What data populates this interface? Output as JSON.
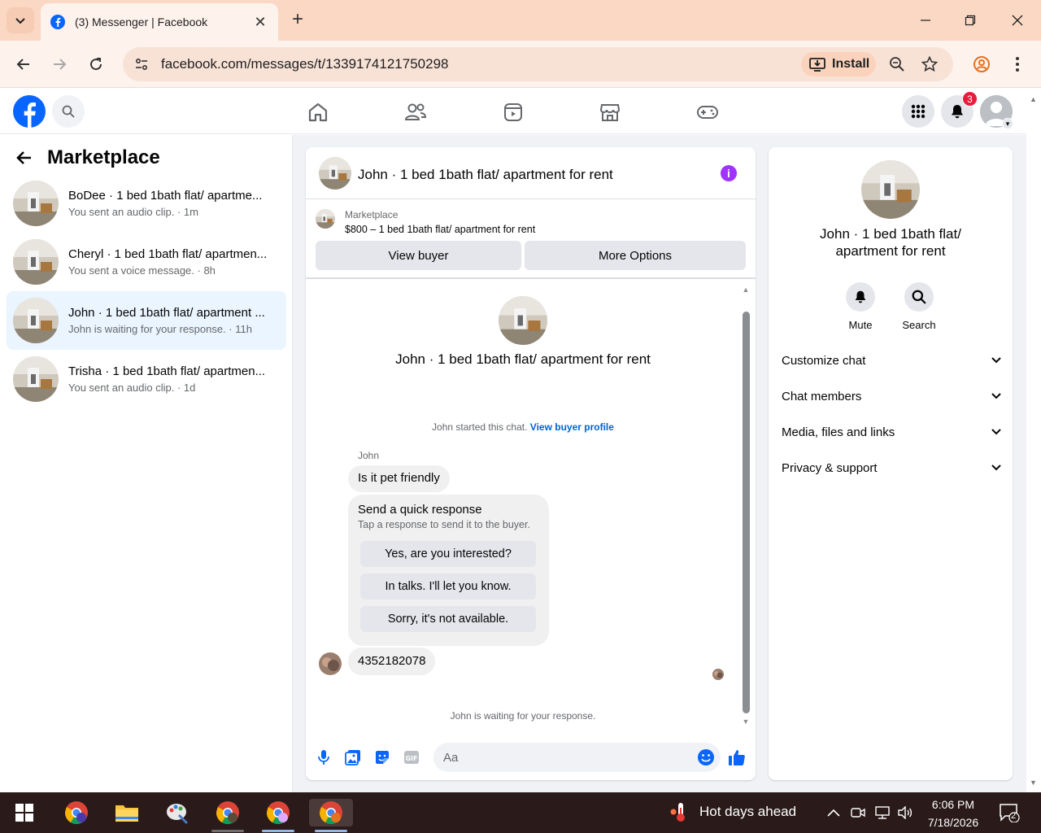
{
  "browser": {
    "tab_title": "(3) Messenger | Facebook",
    "url": "facebook.com/messages/t/1339174121750298",
    "install_label": "Install"
  },
  "header": {
    "notification_count": "3"
  },
  "sidebar": {
    "title": "Marketplace",
    "conversations": [
      {
        "name": "BoDee · 1 bed 1bath flat/ apartme...",
        "snippet": "You sent an audio clip. · 1m",
        "active": false
      },
      {
        "name": "Cheryl · 1 bed 1bath flat/ apartmen...",
        "snippet": "You sent a voice message. · 8h",
        "active": false
      },
      {
        "name": "John · 1 bed 1bath flat/ apartment ...",
        "snippet": "John is waiting for your response. · 11h",
        "active": true
      },
      {
        "name": "Trisha · 1 bed 1bath flat/ apartmen...",
        "snippet": "You sent an audio clip. · 1d",
        "active": false
      }
    ]
  },
  "chat": {
    "title": "John · 1 bed 1bath flat/ apartment for rent",
    "marketplace_label": "Marketplace",
    "listing": "$800 – 1 bed 1bath flat/ apartment for rent",
    "view_buyer": "View buyer",
    "more_options": "More Options",
    "intro_title": "John · 1 bed 1bath flat/ apartment for rent",
    "started_text": "John started this chat.",
    "view_buyer_profile": "View buyer profile",
    "sender_name": "John",
    "message_1": "Is it pet friendly",
    "quick_response_title": "Send a quick response",
    "quick_response_sub": "Tap a response to send it to the buyer.",
    "quick_responses": [
      "Yes, are you interested?",
      "In talks. I'll let you know.",
      "Sorry, it's not available."
    ],
    "message_2": "4352182078",
    "waiting_text": "John is waiting for your response.",
    "composer_placeholder": "Aa"
  },
  "details": {
    "title": "John · 1 bed 1bath flat/ apartment for rent",
    "mute_label": "Mute",
    "search_label": "Search",
    "sections": [
      "Customize chat",
      "Chat members",
      "Media, files and links",
      "Privacy & support"
    ]
  },
  "taskbar": {
    "weather": "Hot days ahead",
    "time": "6:06 PM",
    "date": "7/18/2026",
    "notifications": "2"
  },
  "colors": {
    "fb_blue": "#0866ff",
    "active_conv_bg": "#ebf5ff",
    "info_purple": "#a033ff",
    "chrome_tab_bg": "#fbd8c4"
  }
}
